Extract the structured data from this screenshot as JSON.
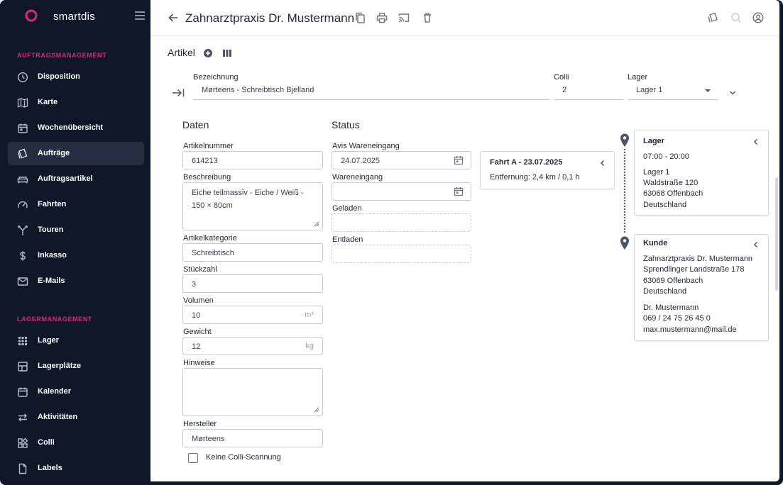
{
  "app": {
    "name": "smartdis"
  },
  "sidebar": {
    "sections": [
      {
        "title": "AUFTRAGSMANAGEMENT"
      },
      {
        "title": "LAGERMANAGEMENT"
      }
    ],
    "items": [
      {
        "label": "Disposition",
        "icon": "clock-icon"
      },
      {
        "label": "Karte",
        "icon": "map-icon"
      },
      {
        "label": "Wochenübersicht",
        "icon": "calendar-icon"
      },
      {
        "label": "Aufträge",
        "icon": "orders-icon",
        "active": true
      },
      {
        "label": "Auftragsartikel",
        "icon": "sofa-icon"
      },
      {
        "label": "Fahrten",
        "icon": "speedometer-icon"
      },
      {
        "label": "Touren",
        "icon": "route-icon"
      },
      {
        "label": "Inkasso",
        "icon": "dollar-icon"
      },
      {
        "label": "E-Mails",
        "icon": "mail-icon"
      },
      {
        "label": "Lager",
        "icon": "grid-icon"
      },
      {
        "label": "Lagerplätze",
        "icon": "layout-icon"
      },
      {
        "label": "Kalender",
        "icon": "calendar-icon"
      },
      {
        "label": "Aktivitäten",
        "icon": "arrows-icon"
      },
      {
        "label": "Colli",
        "icon": "widgets-icon"
      },
      {
        "label": "Labels",
        "icon": "file-icon"
      }
    ]
  },
  "header": {
    "title": "Zahnarztpraxis Dr. Mustermann"
  },
  "artikel": {
    "heading": "Artikel",
    "bezeichnung_label": "Bezeichnung",
    "bezeichnung_value": "Mørteens - Schreibtisch Bjelland",
    "colli_label": "Colli",
    "colli_value": "2",
    "lager_label": "Lager",
    "lager_value": "Lager 1"
  },
  "daten": {
    "heading": "Daten",
    "artikelnummer_label": "Artikelnummer",
    "artikelnummer_value": "614213",
    "beschreibung_label": "Beschreibung",
    "beschreibung_value": "Eiche teilmassiv - Eiche / Weiß - 150 × 80cm",
    "kategorie_label": "Artikelkategorie",
    "kategorie_value": "Schreibtisch",
    "stueckzahl_label": "Stückzahl",
    "stueckzahl_value": "3",
    "volumen_label": "Volumen",
    "volumen_value": "10",
    "volumen_unit": "m³",
    "gewicht_label": "Gewicht",
    "gewicht_value": "12",
    "gewicht_unit": "kg",
    "hinweise_label": "Hinweise",
    "hinweise_value": "",
    "hersteller_label": "Hersteller",
    "hersteller_value": "Mørteens",
    "keine_colli_label": "Keine Colli-Scannung"
  },
  "status": {
    "heading": "Status",
    "avis_label": "Avis Wareneingang",
    "avis_value": "24.07.2025",
    "wareneingang_label": "Wareneingang",
    "wareneingang_value": "",
    "geladen_label": "Geladen",
    "entladen_label": "Entladen"
  },
  "fahrt": {
    "title": "Fahrt A - 23.07.2025",
    "distance": "Entfernung:  2,4 km / 0,1 h"
  },
  "lager_card": {
    "title": "Lager",
    "hours": "07:00 - 20:00",
    "name": "Lager 1",
    "street": "Waldstraße 120",
    "city": "63068 Offenbach",
    "country": "Deutschland"
  },
  "kunde_card": {
    "title": "Kunde",
    "name": "Zahnarztpraxis Dr. Mustermann",
    "street": "Sprendlinger Landstraße 178",
    "city": "63069 Offenbach",
    "country": "Deutschland",
    "contact": "Dr. Mustermann",
    "phone": "069 / 24 75 26 45 0",
    "email": "max.mustermann@mail.de"
  },
  "colors": {
    "sidebar_bg": "#0f1729",
    "accent": "#d6297e",
    "active_item": "#252e42"
  }
}
